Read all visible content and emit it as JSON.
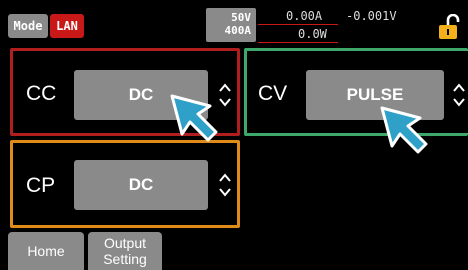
{
  "topbar": {
    "mode_label": "Mode",
    "lan_label": "LAN",
    "voltage_limit": "50V",
    "current_limit": "400A",
    "current_reading": "0.00A",
    "voltage_reading": "-0.001V",
    "power_reading": "0.0W"
  },
  "panels": {
    "cc": {
      "label": "CC",
      "value": "DC"
    },
    "cv": {
      "label": "CV",
      "value": "PULSE"
    },
    "cp": {
      "label": "CP",
      "value": "DC"
    }
  },
  "tabs": [
    {
      "label": "Home"
    },
    {
      "label": "Output Setting"
    }
  ],
  "colors": {
    "cc_border": "#b01e1e",
    "cv_border": "#3ea86a",
    "cp_border": "#e08a1a",
    "lan_badge": "#c81818",
    "lock": "#f2b01a",
    "cursor": "#2fa0c8"
  },
  "icons": [
    "unlock-icon",
    "chevron-updown-icon",
    "pointer-cursor-icon"
  ]
}
